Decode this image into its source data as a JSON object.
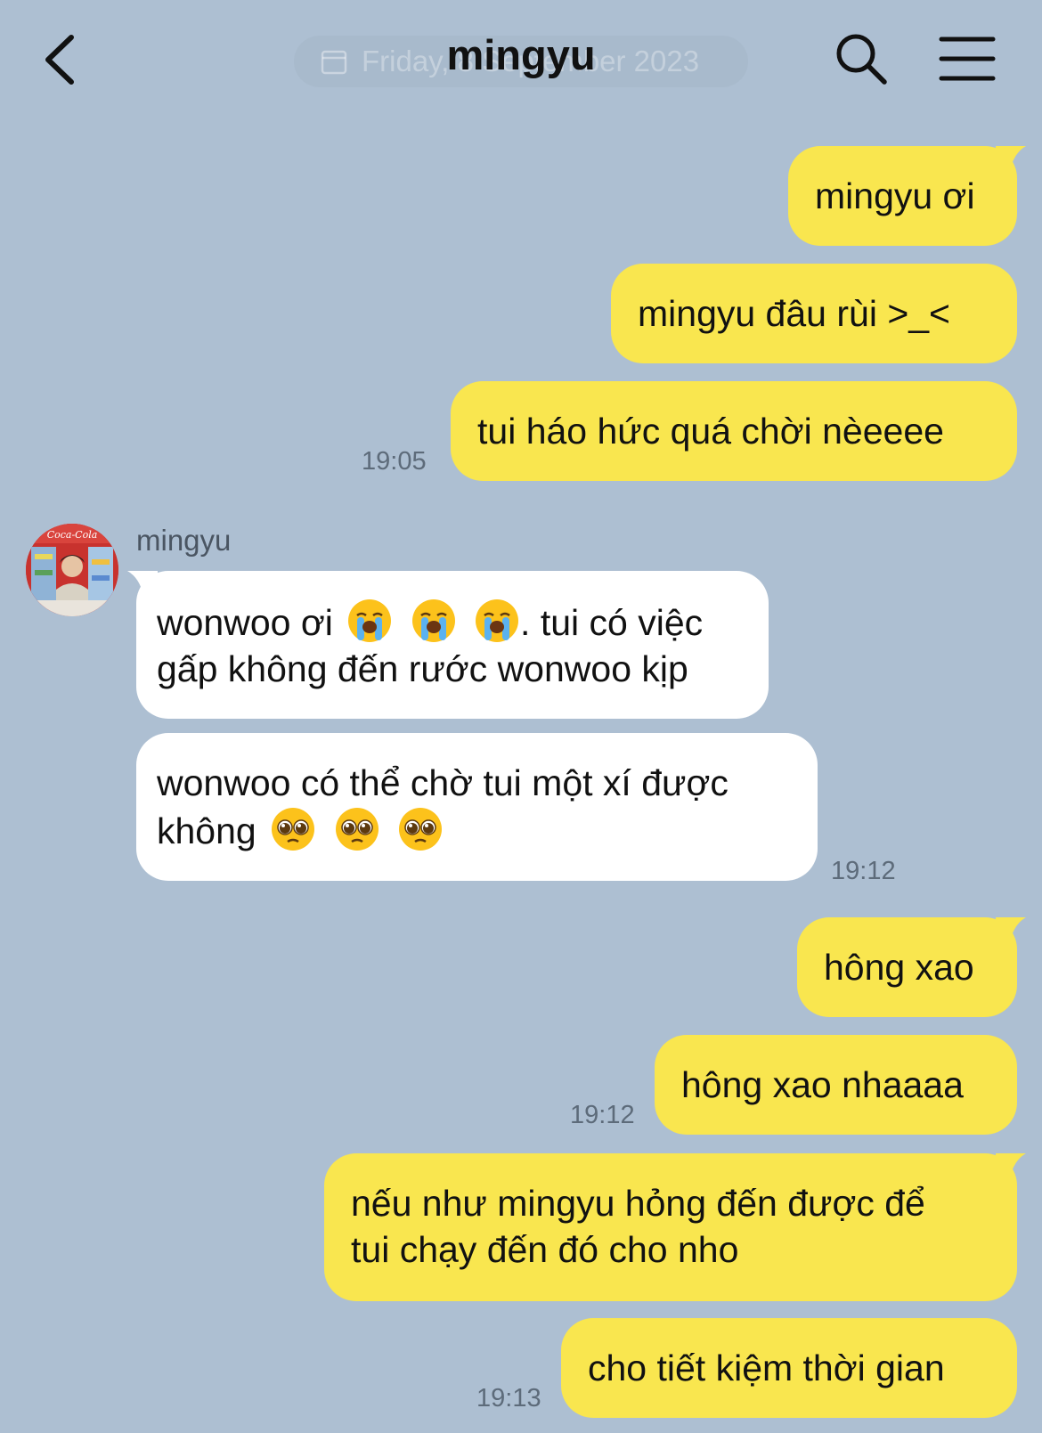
{
  "header": {
    "title": "mingyu",
    "date_pill": "Friday, 8 September 2023"
  },
  "messages": {
    "m1": "mingyu ơi",
    "m2": "mingyu đâu rùi >_<",
    "m3": "tui háo hức quá chời nèeeee",
    "t1": "19:05",
    "sender": "mingyu",
    "r1_a": "wonwoo ơi",
    "r1_b": ". tui có việc gấp không đến rước wonwoo kịp",
    "r2_a": "wonwoo có thể chờ tui một xí được không",
    "t2": "19:12",
    "m4": "hông xao",
    "m5": "hông xao nhaaaa",
    "t3": "19:12",
    "m6_l1": "nếu như mingyu hỏng đến được để",
    "m6_l2": "tui chạy đến đó cho nho",
    "m7": "cho tiết kiệm thời gian",
    "t4": "19:13"
  },
  "colors": {
    "background": "#adbfd2",
    "my_bubble": "#f9e64f",
    "their_bubble": "#ffffff"
  },
  "icons": {
    "back": "chevron-left-icon",
    "search": "search-icon",
    "menu": "hamburger-menu-icon",
    "cry_emoji": "loudly-crying-face-emoji",
    "plead_emoji": "pleading-face-emoji"
  }
}
